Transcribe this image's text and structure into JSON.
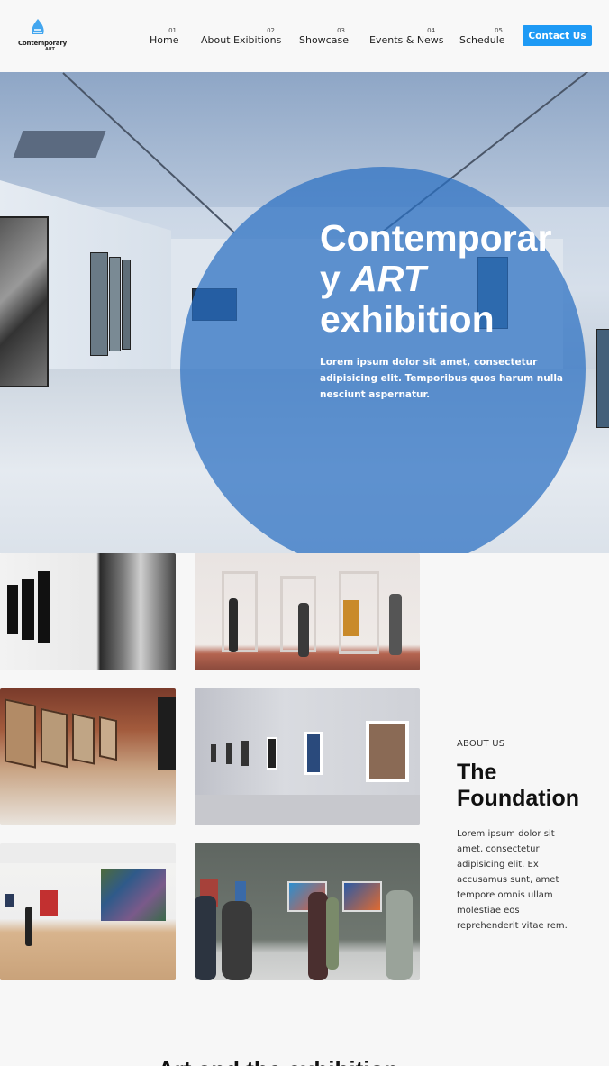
{
  "logo": {
    "text": "Contemporary",
    "sub": "ART"
  },
  "nav": [
    {
      "num": "01",
      "label": "Home"
    },
    {
      "num": "02",
      "label": "About Exibitions"
    },
    {
      "num": "03",
      "label": "Showcase"
    },
    {
      "num": "04",
      "label": "Events & News"
    },
    {
      "num": "05",
      "label": "Schedule"
    }
  ],
  "contact_label": "Contact Us",
  "hero": {
    "title_line1": "Contemporar",
    "title_y": "y ",
    "title_art": "ART",
    "title_line3": "exhibition",
    "description": "Lorem ipsum dolor sit amet, consectetur adipisicing elit. Temporibus quos harum nulla nesciunt aspernatur."
  },
  "about": {
    "eyebrow": "ABOUT US",
    "title": "The Foundation",
    "body": "Lorem ipsum dolor sit amet, consectetur adipisicing elit. Ex accusamus sunt, amet tempore omnis ullam molestiae eos reprehenderit vitae rem."
  },
  "next_heading": "Art and the exhibition",
  "colors": {
    "accent": "#1e9af5",
    "hero_circle": "#2a6fc2"
  }
}
